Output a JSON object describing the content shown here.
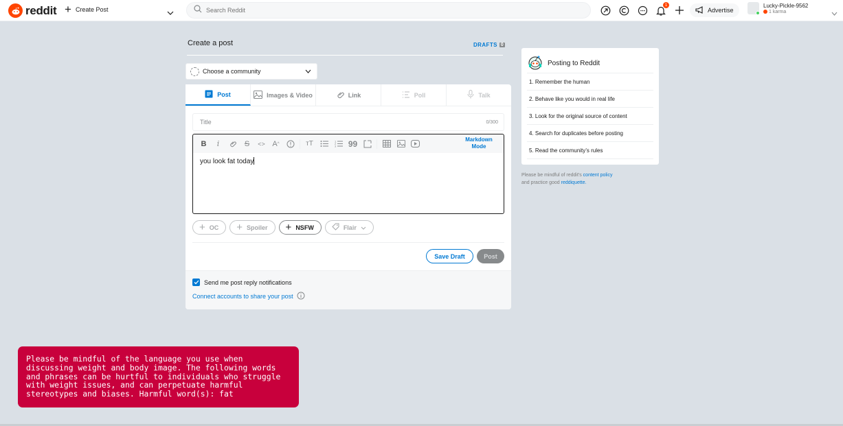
{
  "header": {
    "logo_text": "reddit",
    "create_post_label": "Create Post",
    "search_placeholder": "Search Reddit",
    "notification_count": "1",
    "advertise_label": "Advertise",
    "username": "Lucky-Pickle-9562",
    "karma": "1 karma"
  },
  "main": {
    "title": "Create a post",
    "drafts_label": "DRAFTS",
    "drafts_count": "0",
    "community_placeholder": "Choose a community",
    "tabs": [
      {
        "label": "Post"
      },
      {
        "label": "Images & Video"
      },
      {
        "label": "Link"
      },
      {
        "label": "Poll"
      },
      {
        "label": "Talk"
      }
    ],
    "title_placeholder": "Title",
    "title_count": "0/300",
    "markdown_mode": "Markdown Mode",
    "body_text": "you look fat today",
    "flags": {
      "oc": "OC",
      "spoiler": "Spoiler",
      "nsfw": "NSFW",
      "flair": "Flair"
    },
    "save_draft_label": "Save Draft",
    "post_label": "Post",
    "notifications_label": "Send me post reply notifications",
    "connect_label": "Connect accounts to share your post"
  },
  "sidebar": {
    "title": "Posting to Reddit",
    "rules": [
      "1. Remember the human",
      "2. Behave like you would in real life",
      "3. Look for the original source of content",
      "4. Search for duplicates before posting",
      "5. Read the community’s rules"
    ],
    "policy_prefix": "Please be mindful of reddit's",
    "policy_link": "content policy",
    "policy_middle": "and practice good",
    "policy_link2": "reddiquette."
  },
  "toast": {
    "message": "Please be mindful of the language you use when\ndiscussing weight and body image. The following words\nand phrases can be hurtful to individuals who struggle\nwith weight issues, and can perpetuate harmful\nstereotypes and biases. Harmful word(s): fat"
  },
  "colors": {
    "brand": "#ff4500",
    "accent": "#0079d3",
    "toast": "#c8003c",
    "background": "#dae0e6"
  }
}
